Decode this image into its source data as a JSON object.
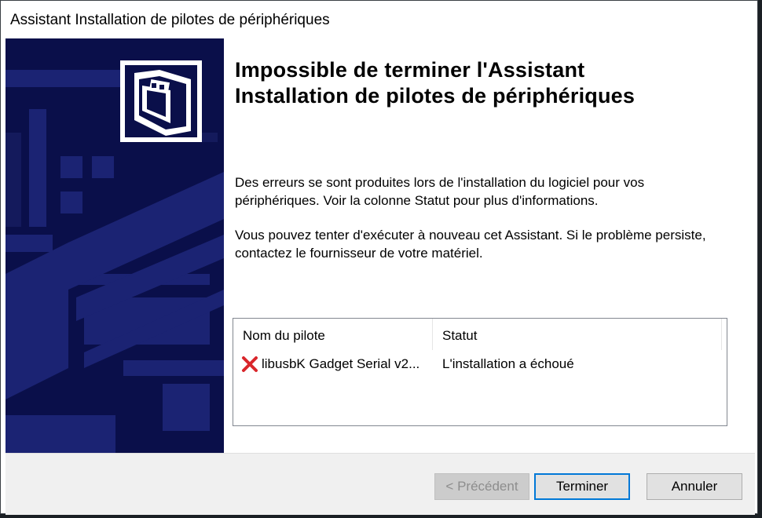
{
  "window": {
    "title": "Assistant Installation de pilotes de périphériques"
  },
  "content": {
    "heading_line1": "Impossible de terminer l'Assistant",
    "heading_line2": "Installation de pilotes de périphériques",
    "paragraph1": "Des erreurs se sont produites lors de l'installation du logiciel pour vos périphériques. Voir la colonne Statut pour plus d'informations.",
    "paragraph2": "Vous pouvez tenter d'exécuter à nouveau cet Assistant. Si le problème persiste, contactez le fournisseur de votre matériel."
  },
  "driver_list": {
    "columns": [
      "Nom du pilote",
      "Statut"
    ],
    "rows": [
      {
        "icon": "error-x-icon",
        "name": "libusbK Gadget Serial v2...",
        "status": "L'installation a échoué"
      }
    ]
  },
  "buttons": {
    "previous": "< Précédent",
    "finish": "Terminer",
    "cancel": "Annuler"
  },
  "colors": {
    "banner": "#0a0f4a",
    "error": "#d9262b",
    "focus": "#0078d7"
  }
}
